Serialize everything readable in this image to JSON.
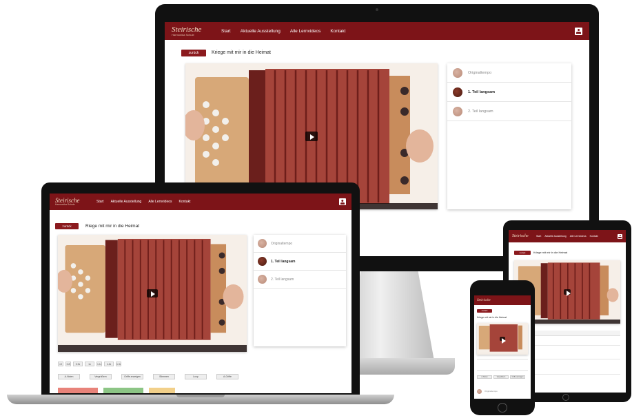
{
  "site": {
    "logo": "Steirische",
    "logo_sub": "Harmonika Schule",
    "nav": [
      "Start",
      "Aktuelle Ausstellung",
      "Alle Lernvideos",
      "Kontakt"
    ],
    "back_label": "zurück",
    "song_title": "Kriege mit mir in die Heimat",
    "song_title_laptop": "Riege mit mir in die Heimat",
    "playlist": [
      {
        "label": "Originaltempo",
        "active": false
      },
      {
        "label": "1. Teil langsam",
        "active": true
      },
      {
        "label": "2. Teil langsam",
        "active": false
      }
    ],
    "speed_options": [
      "×0",
      "0.8",
      "0.9x",
      "1x",
      "1.1x",
      "1.2x",
      "1.3x"
    ],
    "sections": [
      "A-Teil",
      "B-Teil",
      "C-Teil"
    ],
    "chips": [
      "A-Noten",
      "Vergrößern",
      "Griffe anzeigen",
      "Stimmen",
      "Loop",
      "A-Griffe"
    ],
    "bottom_buttons": [
      "",
      "",
      ""
    ]
  },
  "colors": {
    "brand": "#7d1418",
    "accent_red": "#e8837a",
    "accent_green": "#8cc585",
    "accent_yellow": "#f2d08a"
  },
  "icons": [
    "user-icon",
    "play-icon"
  ]
}
